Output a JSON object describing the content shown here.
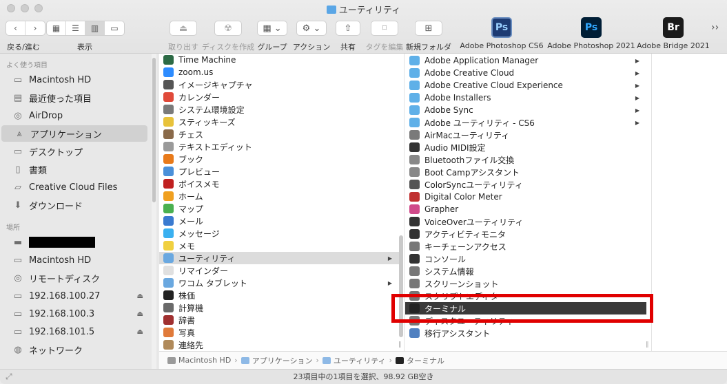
{
  "window": {
    "title": "ユーティリティ",
    "title_icon": "utilities-folder-icon"
  },
  "toolbar": {
    "back_forward_label": "戻る/進む",
    "view_label": "表示",
    "eject_label": "取り出す",
    "burn_label": "ディスクを作成",
    "group_label": "グループ",
    "action_label": "アクション",
    "share_label": "共有",
    "tags_label": "タグを編集",
    "new_folder_label": "新規フォルダ",
    "apps": [
      {
        "label": "Adobe Photoshop CS6",
        "glyph": "Ps",
        "color": "#1d3b73"
      },
      {
        "label": "Adobe Photoshop 2021",
        "glyph": "Ps",
        "color": "#001e36"
      },
      {
        "label": "Adobe Bridge 2021",
        "glyph": "Br",
        "color": "#1b1b1b"
      }
    ],
    "more_glyph": "››"
  },
  "sidebar": {
    "favorites_header": "よく使う項目",
    "locations_header": "場所",
    "favorites": [
      {
        "label": "Macintosh HD",
        "icon": "hard-drive-icon"
      },
      {
        "label": "最近使った項目",
        "icon": "clock-icon"
      },
      {
        "label": "AirDrop",
        "icon": "airdrop-icon"
      },
      {
        "label": "アプリケーション",
        "icon": "applications-icon"
      },
      {
        "label": "デスクトップ",
        "icon": "desktop-icon"
      },
      {
        "label": "書類",
        "icon": "document-icon"
      },
      {
        "label": "Creative Cloud Files",
        "icon": "folder-icon"
      },
      {
        "label": "ダウンロード",
        "icon": "download-icon"
      }
    ],
    "locations": [
      {
        "label": "",
        "icon": "drive-icon"
      },
      {
        "label": "Macintosh HD",
        "icon": "hard-drive-icon"
      },
      {
        "label": "リモートディスク",
        "icon": "disc-icon"
      },
      {
        "label": "192.168.100.27",
        "icon": "display-icon"
      },
      {
        "label": "192.168.100.3",
        "icon": "display-icon"
      },
      {
        "label": "192.168.101.5",
        "icon": "display-icon"
      },
      {
        "label": "ネットワーク",
        "icon": "network-icon"
      }
    ]
  },
  "column1": [
    {
      "label": "Time Machine",
      "color": "#2c6a45"
    },
    {
      "label": "zoom.us",
      "color": "#2d8cff"
    },
    {
      "label": "イメージキャプチャ",
      "color": "#555555"
    },
    {
      "label": "カレンダー",
      "color": "#e04a3a"
    },
    {
      "label": "システム環境設定",
      "color": "#7a7a7a"
    },
    {
      "label": "スティッキーズ",
      "color": "#e8c23a"
    },
    {
      "label": "チェス",
      "color": "#8a6a4a"
    },
    {
      "label": "テキストエディット",
      "color": "#9a9a9a"
    },
    {
      "label": "ブック",
      "color": "#e87a1a"
    },
    {
      "label": "プレビュー",
      "color": "#4a90d9"
    },
    {
      "label": "ボイスメモ",
      "color": "#c02020"
    },
    {
      "label": "ホーム",
      "color": "#f0a020"
    },
    {
      "label": "マップ",
      "color": "#4ab050"
    },
    {
      "label": "メール",
      "color": "#3a7ad0"
    },
    {
      "label": "メッセージ",
      "color": "#3ab0f0"
    },
    {
      "label": "メモ",
      "color": "#f0d040"
    },
    {
      "label": "ユーティリティ",
      "color": "#6aa8e0"
    },
    {
      "label": "リマインダー",
      "color": "#e0e0e0"
    },
    {
      "label": "ワコム タブレット",
      "color": "#6aa8e0"
    },
    {
      "label": "株価",
      "color": "#222222"
    },
    {
      "label": "計算機",
      "color": "#6a6a6a"
    },
    {
      "label": "辞書",
      "color": "#a03030"
    },
    {
      "label": "写真",
      "color": "#e07a3a"
    },
    {
      "label": "連絡先",
      "color": "#b08a5a"
    }
  ],
  "column2": [
    {
      "label": "Adobe Application Manager",
      "color": "#5fb0e8"
    },
    {
      "label": "Adobe Creative Cloud",
      "color": "#5fb0e8"
    },
    {
      "label": "Adobe Creative Cloud Experience",
      "color": "#5fb0e8"
    },
    {
      "label": "Adobe Installers",
      "color": "#5fb0e8"
    },
    {
      "label": "Adobe Sync",
      "color": "#5fb0e8"
    },
    {
      "label": "Adobe ユーティリティ - CS6",
      "color": "#5fb0e8"
    },
    {
      "label": "AirMacユーティリティ",
      "color": "#7a7a7a"
    },
    {
      "label": "Audio MIDI設定",
      "color": "#333333"
    },
    {
      "label": "Bluetoothファイル交換",
      "color": "#888888"
    },
    {
      "label": "Boot Campアシスタント",
      "color": "#888888"
    },
    {
      "label": "ColorSyncユーティリティ",
      "color": "#555555"
    },
    {
      "label": "Digital Color Meter",
      "color": "#c03030"
    },
    {
      "label": "Grapher",
      "color": "#d04a8a"
    },
    {
      "label": "VoiceOverユーティリティ",
      "color": "#333333"
    },
    {
      "label": "アクティビティモニタ",
      "color": "#333333"
    },
    {
      "label": "キーチェーンアクセス",
      "color": "#777777"
    },
    {
      "label": "コンソール",
      "color": "#333333"
    },
    {
      "label": "システム情報",
      "color": "#777777"
    },
    {
      "label": "スクリーンショット",
      "color": "#777777"
    },
    {
      "label": "スクリプトエディタ",
      "color": "#777777"
    },
    {
      "label": "ターミナル",
      "color": "#222222"
    },
    {
      "label": "ディスクユーティリティ",
      "color": "#777777"
    },
    {
      "label": "移行アシスタント",
      "color": "#5080c0"
    }
  ],
  "path": [
    "Macintosh HD",
    "アプリケーション",
    "ユーティリティ",
    "ターミナル"
  ],
  "status": {
    "text": "23項目中の1項目を選択、98.92 GB空き"
  }
}
